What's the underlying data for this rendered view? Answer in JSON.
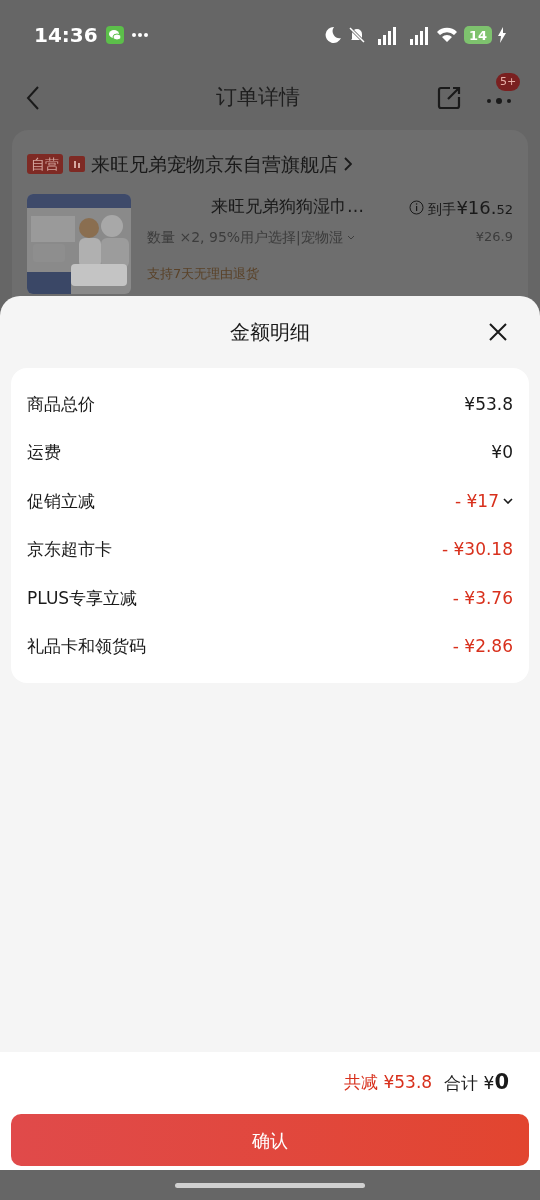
{
  "status_bar": {
    "time": "14:36",
    "battery": "14"
  },
  "nav": {
    "title": "订单详情",
    "badge": "5+"
  },
  "store": {
    "tag": "自营",
    "name": "来旺兄弟宠物京东自营旗舰店"
  },
  "product": {
    "title": "来旺兄弟狗狗湿巾…",
    "spec": "数量 ×2, 95%用户选择|宠物湿",
    "price_label": "到手",
    "price": "¥16.",
    "price_decimal": "52",
    "original_price": "¥26.9",
    "service": "支持7天无理由退货"
  },
  "sheet": {
    "title": "金额明细",
    "rows": [
      {
        "label": "商品总价",
        "value": "¥53.8",
        "kind": "plain",
        "expandable": false
      },
      {
        "label": "运费",
        "value": "¥0",
        "kind": "plain",
        "expandable": false
      },
      {
        "label": "促销立减",
        "value": "- ¥17",
        "kind": "discount",
        "expandable": true
      },
      {
        "label": "京东超市卡",
        "value": "- ¥30.18",
        "kind": "discount",
        "expandable": false
      },
      {
        "label": "PLUS专享立减",
        "value": "- ¥3.76",
        "kind": "discount",
        "expandable": false
      },
      {
        "label": "礼品卡和领货码",
        "value": "- ¥2.86",
        "kind": "discount",
        "expandable": false
      }
    ]
  },
  "footer": {
    "saved_label": "共减",
    "saved": "¥53.8",
    "total_label": "合计",
    "total_prefix": "¥",
    "total": "0",
    "button": "确认"
  }
}
